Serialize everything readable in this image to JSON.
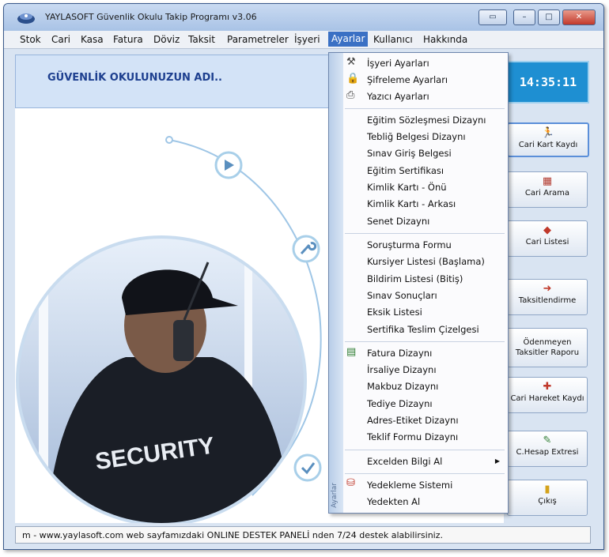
{
  "window": {
    "title": "YAYLASOFT Güvenlik Okulu Takip Programı v3.06",
    "buttons": [
      "▭",
      "–",
      "□",
      "✕"
    ]
  },
  "menubar": [
    {
      "label": "Stok"
    },
    {
      "label": "Cari"
    },
    {
      "label": "Kasa"
    },
    {
      "label": "Fatura"
    },
    {
      "label": "Döviz"
    },
    {
      "label": "Taksit"
    },
    {
      "label": "Parametreler"
    },
    {
      "label": "İşyeri"
    },
    {
      "label": "Ayarlar",
      "active": true
    },
    {
      "label": "Kullanıcı"
    },
    {
      "label": "Hakkında"
    }
  ],
  "header": {
    "school_name": "GÜVENLİK OKULUNUZUN  ADI..",
    "clock": "14:35:11"
  },
  "banner": {
    "jacket_text": "SECURITY"
  },
  "dropdown": {
    "strip_label": "Ayarlar",
    "groups": [
      [
        {
          "label": "İşyeri Ayarları",
          "icon": "tools-icon"
        },
        {
          "label": "Şifreleme Ayarları",
          "icon": "lock-icon"
        },
        {
          "label": "Yazıcı Ayarları",
          "icon": "printer-icon"
        }
      ],
      [
        {
          "label": "Eğitim Sözleşmesi Dizaynı"
        },
        {
          "label": "Tebliğ Belgesi Dizaynı"
        },
        {
          "label": "Sınav Giriş Belgesi"
        },
        {
          "label": "Eğitim Sertifikası"
        },
        {
          "label": "Kimlik Kartı - Önü"
        },
        {
          "label": "Kimlik Kartı - Arkası"
        },
        {
          "label": "Senet Dizaynı"
        }
      ],
      [
        {
          "label": "Soruşturma Formu"
        },
        {
          "label": "Kursiyer Listesi (Başlama)"
        },
        {
          "label": "Bildirim Listesi (Bitiş)"
        },
        {
          "label": "Sınav Sonuçları"
        },
        {
          "label": "Eksik Listesi"
        },
        {
          "label": "Sertifika Teslim Çizelgesi"
        }
      ],
      [
        {
          "label": "Fatura Dizaynı",
          "icon": "form-icon"
        },
        {
          "label": "İrsaliye Dizaynı"
        },
        {
          "label": "Makbuz Dizaynı"
        },
        {
          "label": "Tediye Dizaynı"
        },
        {
          "label": "Adres-Etiket Dizaynı"
        },
        {
          "label": "Teklif Formu Dizaynı"
        }
      ],
      [
        {
          "label": "Excelden Bilgi Al",
          "submenu": true
        }
      ],
      [
        {
          "label": "Yedekleme Sistemi",
          "icon": "backup-icon"
        },
        {
          "label": "Yedekten Al"
        }
      ]
    ]
  },
  "sidebar": [
    {
      "label": "Cari Kart Kaydı",
      "icon": "🏃",
      "selected": true
    },
    {
      "label": "Cari Arama",
      "icon": "▦"
    },
    {
      "label": "Cari Listesi",
      "icon": "◆"
    },
    {
      "label": "Taksitlendirme",
      "icon": "➜"
    },
    {
      "label": "Ödenmeyen Taksitler Raporu",
      "icon": ""
    },
    {
      "label": "Cari Hareket Kaydı",
      "icon": "✚"
    },
    {
      "label": "C.Hesap Extresi",
      "icon": "✎"
    },
    {
      "label": "Çıkış",
      "icon": "▮"
    }
  ],
  "status": {
    "text": "m  -  www.yaylasoft.com web sayfamızdaki ONLINE DESTEK PANELİ nden 7/24 destek alabilirsiniz."
  },
  "colors": {
    "accent": "#3a70c4",
    "clock_bg": "#1e8fd2",
    "school_text": "#1d3f8f"
  }
}
